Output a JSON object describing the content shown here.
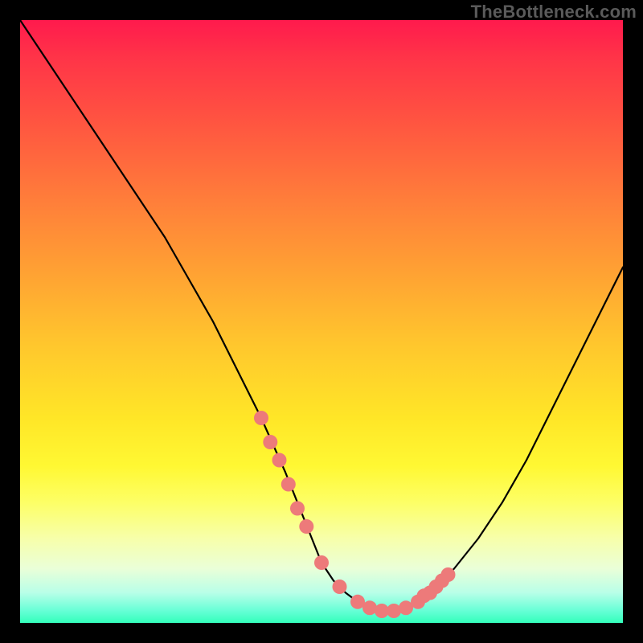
{
  "watermark": "TheBottleneck.com",
  "colors": {
    "marker": "#ed7a7a",
    "curve": "#000000",
    "gradient_top": "#ff1a4d",
    "gradient_bottom": "#33ffbb",
    "background": "#000000"
  },
  "chart_data": {
    "type": "line",
    "title": "",
    "xlabel": "",
    "ylabel": "",
    "xlim": [
      0,
      100
    ],
    "ylim": [
      0,
      100
    ],
    "x": [
      0,
      4,
      8,
      12,
      16,
      20,
      24,
      28,
      32,
      36,
      40,
      44,
      48,
      50,
      52,
      54,
      56,
      58,
      60,
      62,
      64,
      66,
      68,
      72,
      76,
      80,
      84,
      88,
      92,
      96,
      100
    ],
    "values": [
      100,
      94,
      88,
      82,
      76,
      70,
      64,
      57,
      50,
      42,
      34,
      25,
      15,
      10,
      7,
      5,
      3.5,
      2.5,
      2,
      2,
      2.5,
      3.5,
      5,
      9,
      14,
      20,
      27,
      35,
      43,
      51,
      59
    ],
    "markers": {
      "x": [
        40,
        41.5,
        43,
        44.5,
        46,
        47.5,
        50,
        53,
        56,
        58,
        60,
        62,
        64,
        66,
        67,
        68,
        69,
        70,
        71
      ],
      "y": [
        34,
        30,
        27,
        23,
        19,
        16,
        10,
        6,
        3.5,
        2.5,
        2,
        2,
        2.5,
        3.5,
        4.5,
        5,
        6,
        7,
        8
      ]
    }
  }
}
